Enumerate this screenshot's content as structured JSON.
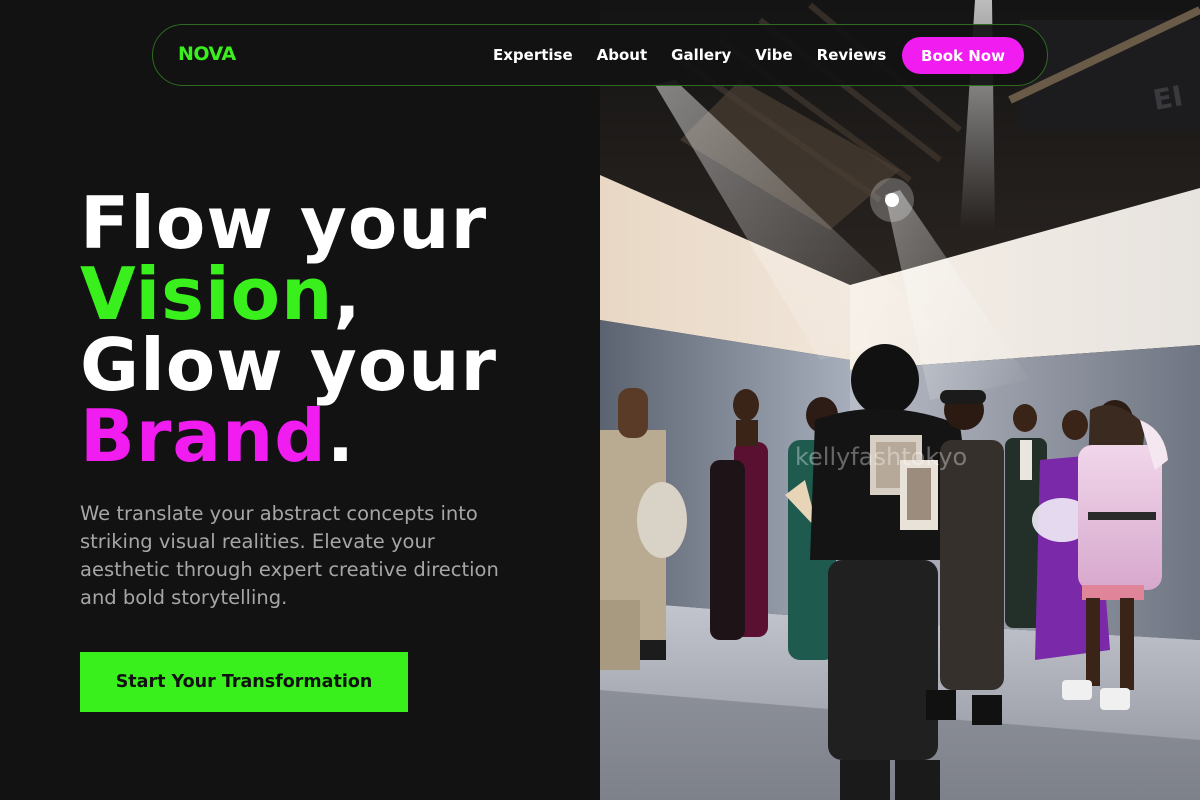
{
  "nav": {
    "brand": "NOVA",
    "links": [
      "Expertise",
      "About",
      "Gallery",
      "Vibe",
      "Reviews"
    ],
    "cta": "Book Now"
  },
  "hero": {
    "line1": "Flow your",
    "line2_accent": "Vision",
    "line2_punct": ",",
    "line3": "Glow your",
    "line4_accent": "Brand",
    "line4_punct": ".",
    "subtitle": "We translate your abstract concepts into striking visual realities. Elevate your aesthetic through expert creative direction and bold storytelling.",
    "cta": "Start Your Transformation"
  },
  "photo": {
    "watermark": "kellyfashtokyo"
  },
  "colors": {
    "background": "#121212",
    "accent_green": "#39f01d",
    "accent_pink": "#f01cf0",
    "subtitle_gray": "#a6a6a6"
  }
}
